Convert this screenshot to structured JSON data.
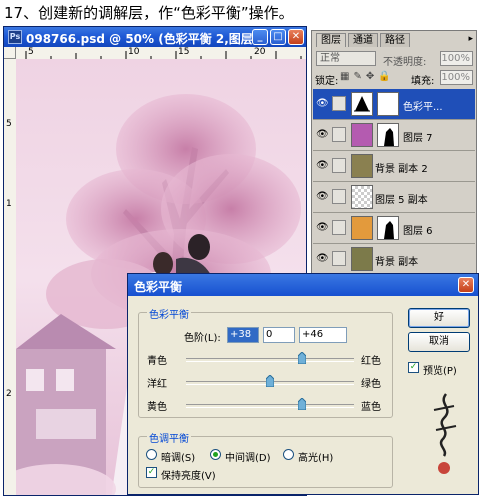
{
  "step_heading": "17、创建新的调解层，作“色彩平衡”操作。",
  "document": {
    "title": "098766.psd @ 50% (色彩平衡 2,图层...",
    "ruler_top_labels": [
      "5",
      "10",
      "15",
      "20"
    ],
    "ruler_left_labels": [
      "5",
      "1",
      "2"
    ]
  },
  "layers_panel": {
    "tabs": [
      "图层",
      "通道",
      "路径"
    ],
    "blend_mode": "正常",
    "opacity_label": "不透明度:",
    "opacity_value": "100%",
    "lock_label": "锁定:",
    "fill_label": "填充:",
    "fill_value": "100%",
    "layers": [
      {
        "name": "色彩平...",
        "selected": true,
        "thumb": "adjustment"
      },
      {
        "name": "图层 7",
        "selected": false,
        "thumb": "photo-mask"
      },
      {
        "name": "背景 副本 2",
        "selected": false,
        "thumb": "photo"
      },
      {
        "name": "图层 5 副本",
        "selected": false,
        "thumb": "transparent"
      },
      {
        "name": "图层 6",
        "selected": false,
        "thumb": "orange-mask"
      },
      {
        "name": "背景 副本",
        "selected": false,
        "thumb": "photo"
      }
    ]
  },
  "dialog": {
    "title": "色彩平衡",
    "group_balance": "色彩平衡",
    "levels_label": "色阶(L):",
    "level_values": [
      "+38",
      "0",
      "+46"
    ],
    "sliders": [
      {
        "left": "青色",
        "right": "红色",
        "position": 0.69
      },
      {
        "left": "洋红",
        "right": "绿色",
        "position": 0.5
      },
      {
        "left": "黄色",
        "right": "蓝色",
        "position": 0.69
      }
    ],
    "group_tone": "色调平衡",
    "tone_options": [
      {
        "label": "暗调(S)",
        "checked": false
      },
      {
        "label": "中间调(D)",
        "checked": true
      },
      {
        "label": "高光(H)",
        "checked": false
      }
    ],
    "preserve_luminosity": "保持亮度(V)",
    "ok_label": "好",
    "cancel_label": "取消",
    "preview_label": "预览(P)"
  },
  "colors": {
    "accent": "#316ac5",
    "title_blue": "#1f5ad6",
    "legend_blue": "#0046d5",
    "photo_pink": "#e8bfd6",
    "selected_layer": "#1f4fb8"
  }
}
